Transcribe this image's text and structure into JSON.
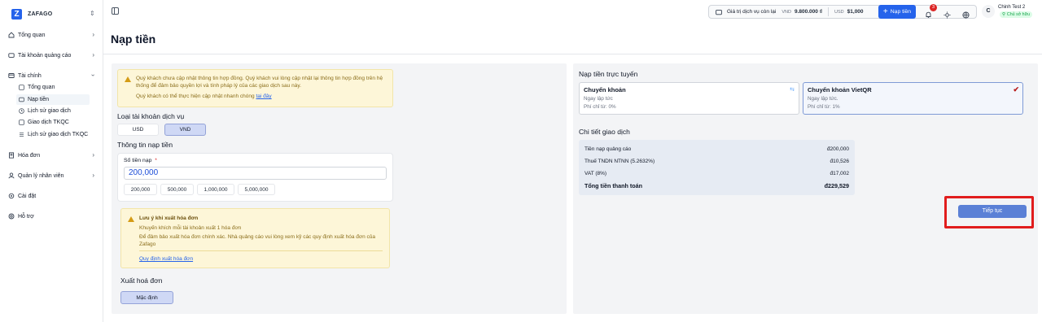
{
  "sidebar": {
    "brand": "ZAFAGO",
    "items": [
      {
        "label": "Tổng quan"
      },
      {
        "label": "Tài khoản quảng cáo"
      },
      {
        "label": "Tài chính"
      },
      {
        "label": "Hóa đơn"
      },
      {
        "label": "Quản lý nhân viên"
      },
      {
        "label": "Cài đặt"
      },
      {
        "label": "Hỗ trợ"
      }
    ],
    "finance_sub": [
      {
        "label": "Tổng quan"
      },
      {
        "label": "Nạp tiền"
      },
      {
        "label": "Lịch sử giao dịch"
      },
      {
        "label": "Giao dịch TKQC"
      },
      {
        "label": "Lịch sử giao dịch TKQC"
      }
    ]
  },
  "topbar": {
    "service_value_label": "Giá trị dịch vụ còn lại",
    "vnd_label": "VND",
    "vnd_value": "9.800.000 ₫",
    "usd_label": "USD",
    "usd_value": "$1,000",
    "deposit_button": "Nạp tiền",
    "notification_count": "3",
    "avatar_initial": "C",
    "user_name": "Chinh Test 2",
    "user_role": "Chủ sở hữu"
  },
  "page": {
    "title": "Nạp tiền"
  },
  "left": {
    "warning_text": "Quý khách chưa cập nhật thông tin hợp đồng. Quý khách vui lòng cập nhật lại thông tin hợp đồng trên hệ thống để đảm bảo quyền lợi và tính pháp lý của các giao dịch sau này.",
    "warning_link_prefix": "Quý khách có thể thực hiện cập nhật nhanh chóng",
    "warning_link": "tại đây",
    "account_type_title": "Loại tài khoản dịch vụ",
    "account_types": [
      "USD",
      "VND"
    ],
    "selected_account_type": "VND",
    "deposit_info_title": "Thông tin nạp tiền",
    "amount_label": "Số tiền nạp",
    "required_mark": "*",
    "amount_value": "200,000",
    "quick_amounts": [
      "200,000",
      "500,000",
      "1,000,000",
      "5,000,000"
    ],
    "invoice_note_title": "Lưu ý khi xuất hóa đơn",
    "invoice_note_line1": "Khuyến khích mỗi tài khoản xuất 1 hóa đơn",
    "invoice_note_line2": "Để đảm bảo xuất hóa đơn chính xác. Nhà quảng cáo vui lòng xem kỹ các quy định xuất hóa đơn của Zafago",
    "invoice_rules_link": "Quy định xuất hóa đơn",
    "invoice_export_title": "Xuất hoá đơn",
    "invoice_default_button": "Mặc định"
  },
  "right": {
    "online_title": "Nạp tiền trực tuyến",
    "methods": [
      {
        "name": "Chuyển khoản",
        "speed": "Ngay lập tức",
        "fee": "Phí chỉ từ: 0%"
      },
      {
        "name": "Chuyển khoản VietQR",
        "speed": "Ngay lập tức.",
        "fee": "Phí chỉ từ: 1%"
      }
    ],
    "details_title": "Chi tiết giao dịch",
    "details": [
      {
        "label": "Tiền nạp quảng cáo",
        "value": "đ200,000"
      },
      {
        "label": "Thuế TNDN NTNN (5.2632%)",
        "value": "đ10,526"
      },
      {
        "label": "VAT (8%)",
        "value": "đ17,002"
      }
    ],
    "total_label": "Tổng tiền thanh toán",
    "total_value": "đ229,529",
    "continue_button": "Tiếp tục",
    "highlight_color": "#e11d1d"
  }
}
